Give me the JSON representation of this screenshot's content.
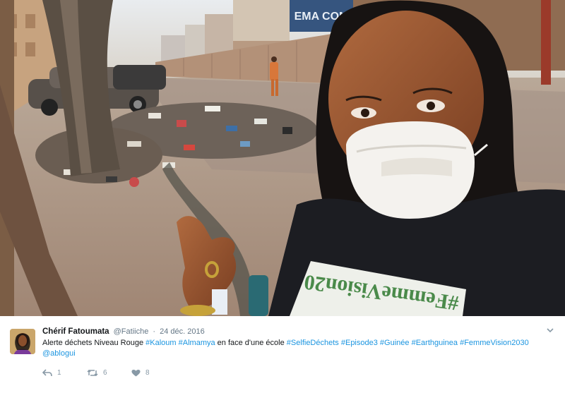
{
  "tweet": {
    "author_name": "Chérif Fatoumata",
    "handle": "@Fatiiche",
    "separator": "·",
    "date": "24 déc. 2016",
    "text_segments": [
      {
        "text": "Alerte déchets Niveau Rouge ",
        "kind": "plain"
      },
      {
        "text": "#Kaloum",
        "kind": "hashtag"
      },
      {
        "text": " ",
        "kind": "plain"
      },
      {
        "text": "#Almamya",
        "kind": "hashtag"
      },
      {
        "text": " en face d'une école ",
        "kind": "plain"
      },
      {
        "text": "#SelfieDéchets",
        "kind": "hashtag"
      },
      {
        "text": " ",
        "kind": "plain"
      },
      {
        "text": "#Episode3",
        "kind": "hashtag"
      },
      {
        "text": " ",
        "kind": "plain"
      },
      {
        "text": "#Guinée",
        "kind": "hashtag"
      },
      {
        "text": " ",
        "kind": "plain"
      },
      {
        "text": "#Earthguinea",
        "kind": "hashtag"
      },
      {
        "text": " ",
        "kind": "plain"
      },
      {
        "text": "#FemmeVision2030",
        "kind": "hashtag"
      },
      {
        "text": " ",
        "kind": "plain"
      },
      {
        "text": "@ablogui",
        "kind": "mention"
      }
    ],
    "actions": {
      "reply_count": "1",
      "retweet_count": "6",
      "like_count": "8"
    },
    "colors": {
      "link": "#1b95e0",
      "muted": "#657786",
      "icon": "#8899a6"
    }
  },
  "photo": {
    "billboard_text": "EMA COM",
    "shirt_text": "#FemmeVision20"
  },
  "icons": {
    "reply": "reply-icon",
    "retweet": "retweet-icon",
    "like": "heart-icon",
    "menu": "chevron-down-icon"
  }
}
